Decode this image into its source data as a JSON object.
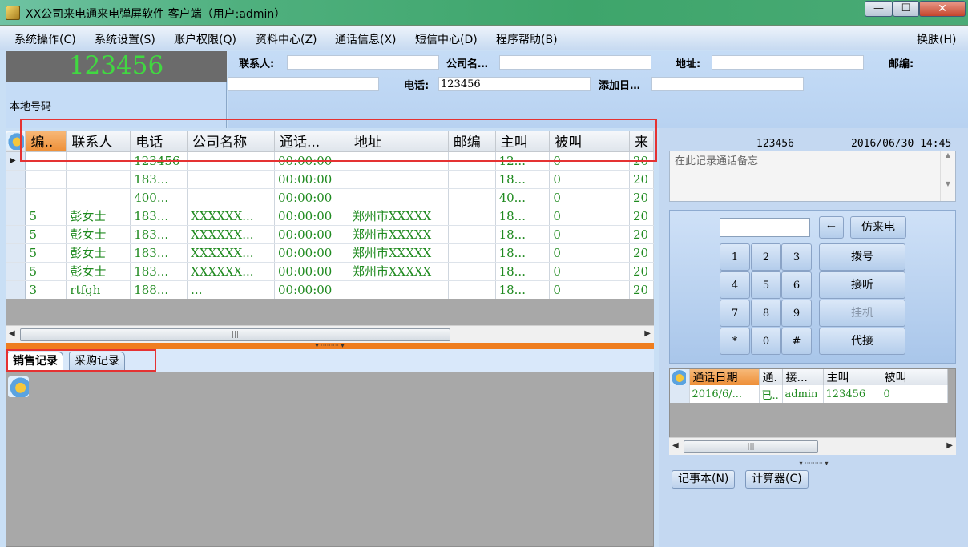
{
  "window": {
    "title": "XX公司来电通来电弹屏软件 客户端（用户:admin）",
    "minimize": "—",
    "maximize": "☐",
    "close": "✕"
  },
  "menu": [
    {
      "label": "系统操作(C)"
    },
    {
      "label": "系统设置(S)"
    },
    {
      "label": "账户权限(Q)"
    },
    {
      "label": "资料中心(Z)"
    },
    {
      "label": "通话信息(X)"
    },
    {
      "label": "短信中心(D)"
    },
    {
      "label": "程序帮助(B)"
    }
  ],
  "skin_menu": "换肤(H)",
  "local": {
    "number": "123456",
    "label": "本地号码"
  },
  "info": {
    "contact_label": "联系人:",
    "contact_value": "",
    "company_label": "公司名…",
    "company_value": "",
    "address_label": "地址:",
    "address_value": "",
    "zip_label": "邮编:",
    "zip_value": "",
    "phone_label": "电话:",
    "phone_value": "123456",
    "added_label": "添加日…",
    "added_value": ""
  },
  "grid": {
    "columns": [
      "编..",
      "联系人",
      "电话",
      "公司名称",
      "通话...",
      "地址",
      "邮编",
      "主叫",
      "被叫",
      "来"
    ],
    "rows": [
      [
        "",
        "",
        "123456",
        "",
        "00:00:00",
        "",
        "",
        "12...",
        "0",
        "20"
      ],
      [
        "",
        "",
        "183...",
        "",
        "00:00:00",
        "",
        "",
        "18...",
        "0",
        "20"
      ],
      [
        "",
        "",
        "400...",
        "",
        "00:00:00",
        "",
        "",
        "40...",
        "0",
        "20"
      ],
      [
        "5",
        "彭女士",
        "183...",
        "XXXXXX...",
        "00:00:00",
        "郑州市XXXXX",
        "",
        "18...",
        "0",
        "20"
      ],
      [
        "5",
        "彭女士",
        "183...",
        "XXXXXX...",
        "00:00:00",
        "郑州市XXXXX",
        "",
        "18...",
        "0",
        "20"
      ],
      [
        "5",
        "彭女士",
        "183...",
        "XXXXXX...",
        "00:00:00",
        "郑州市XXXXX",
        "",
        "18...",
        "0",
        "20"
      ],
      [
        "5",
        "彭女士",
        "183...",
        "XXXXXX...",
        "00:00:00",
        "郑州市XXXXX",
        "",
        "18...",
        "0",
        "20"
      ],
      [
        "3",
        "rtfgh",
        "188...",
        "...",
        "00:00:00",
        "",
        "",
        "18...",
        "0",
        "20"
      ]
    ]
  },
  "tabs": [
    {
      "label": "销售记录"
    },
    {
      "label": "采购记录"
    }
  ],
  "call": {
    "number": "123456",
    "datetime": "2016/06/30 14:45",
    "memo_placeholder": "在此记录通话备忘"
  },
  "dialpad": {
    "backspace": "←",
    "simulate": "仿来电",
    "keys": [
      "1",
      "2",
      "3",
      "4",
      "5",
      "6",
      "7",
      "8",
      "9",
      "*",
      "0",
      "#"
    ],
    "dial": "拨号",
    "answer": "接听",
    "hangup": "挂机",
    "pickup": "代接"
  },
  "log": {
    "columns": [
      "通话日期",
      "通.",
      "接...",
      "主叫",
      "被叫"
    ],
    "rows": [
      [
        "2016/6/...",
        "已..",
        "admin",
        "123456",
        "0"
      ]
    ]
  },
  "tools": {
    "notepad": "记事本(N)",
    "calculator": "计算器(C)"
  },
  "colors": {
    "accent_orange": "#ef7d1e",
    "highlight_red": "#e53232",
    "number_green": "#41d841",
    "cell_green": "#1f8a1f"
  }
}
